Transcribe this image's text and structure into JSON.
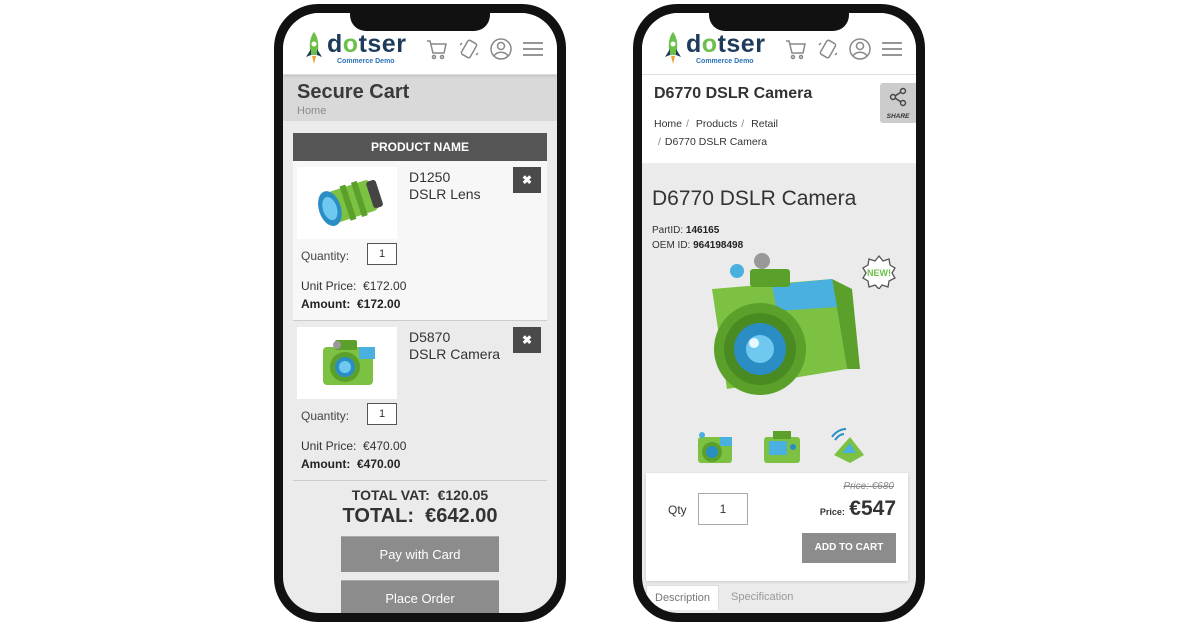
{
  "brand": {
    "name_start": "d",
    "name_o": "o",
    "name_end": "tser",
    "subtitle": "Commerce Demo"
  },
  "header_icons": [
    "cart-icon",
    "phone-icon",
    "user-icon",
    "menu-icon"
  ],
  "colors": {
    "brand_green": "#6cc04a",
    "brand_navy": "#1f3b5c",
    "button_grey": "#8c8c8c"
  },
  "cart": {
    "title": "Secure Cart",
    "breadcrumb": "Home",
    "column_header": "PRODUCT NAME",
    "items": [
      {
        "code": "D1250",
        "name": "DSLR Lens",
        "remove_label": "✖",
        "quantity_label": "Quantity:",
        "quantity": "1",
        "unit_price_label": "Unit Price:",
        "unit_price": "€172.00",
        "amount_label": "Amount:",
        "amount": "€172.00"
      },
      {
        "code": "D5870",
        "name": "DSLR Camera",
        "remove_label": "✖",
        "quantity_label": "Quantity:",
        "quantity": "1",
        "unit_price_label": "Unit Price:",
        "unit_price": "€470.00",
        "amount_label": "Amount:",
        "amount": "€470.00"
      }
    ],
    "total_vat_label": "TOTAL VAT:",
    "total_vat": "€120.05",
    "total_label": "TOTAL:",
    "total": "€642.00",
    "pay_card_label": "Pay with Card",
    "place_order_label": "Place Order"
  },
  "product": {
    "header_title": "D6770 DSLR Camera",
    "breadcrumb": [
      "Home",
      "Products",
      "Retail",
      "D6770 DSLR Camera"
    ],
    "share_label": "SHARE",
    "title": "D6770 DSLR Camera",
    "part_id_label": "PartID:",
    "part_id": "146165",
    "oem_id_label": "OEM ID:",
    "oem_id": "964198498",
    "badge": "NEW!",
    "qty_label": "Qty",
    "qty": "1",
    "old_price": "Price: €680",
    "price_label": "Price:",
    "price": "€547",
    "add_to_cart_label": "ADD TO CART",
    "tabs": [
      "Description",
      "Specification"
    ]
  }
}
